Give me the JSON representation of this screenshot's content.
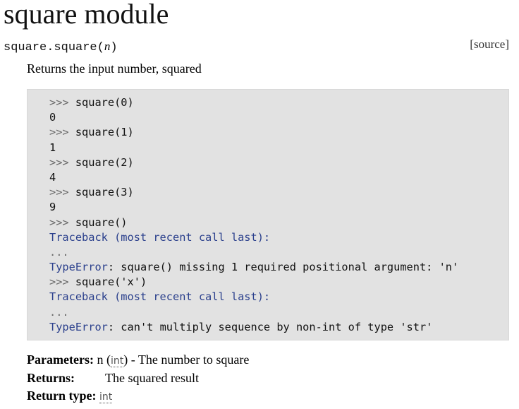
{
  "module": {
    "title": "square module"
  },
  "signature": {
    "name": "square.square",
    "open_paren": "(",
    "param": "n",
    "close_paren": ")",
    "source_label": "[source]"
  },
  "description": "Returns the input number, squared",
  "code_example": {
    "lines": [
      {
        "prompt": ">>> ",
        "code": "square(0)"
      },
      {
        "output": "0"
      },
      {
        "prompt": ">>> ",
        "code": "square(1)"
      },
      {
        "output": "1"
      },
      {
        "prompt": ">>> ",
        "code": "square(2)"
      },
      {
        "output": "4"
      },
      {
        "prompt": ">>> ",
        "code": "square(3)"
      },
      {
        "output": "9"
      },
      {
        "prompt": ">>> ",
        "code": "square()"
      },
      {
        "traceback": "Traceback (most recent call last):"
      },
      {
        "ellipsis": "..."
      },
      {
        "error_name": "TypeError",
        "error_msg": ": square() missing 1 required positional argument: 'n'"
      },
      {
        "prompt": ">>> ",
        "code": "square('x')"
      },
      {
        "traceback": "Traceback (most recent call last):"
      },
      {
        "ellipsis": "..."
      },
      {
        "error_name": "TypeError",
        "error_msg": ": can't multiply sequence by non-int of type 'str'"
      }
    ]
  },
  "fields": {
    "parameters_label": "Parameters:",
    "param_name": "n",
    "param_open": " (",
    "param_type": "int",
    "param_close": ")",
    "param_desc": " - The number to square",
    "returns_label": "Returns:",
    "returns_desc": "The squared result",
    "return_type_label": "Return type:",
    "return_type": "int"
  }
}
